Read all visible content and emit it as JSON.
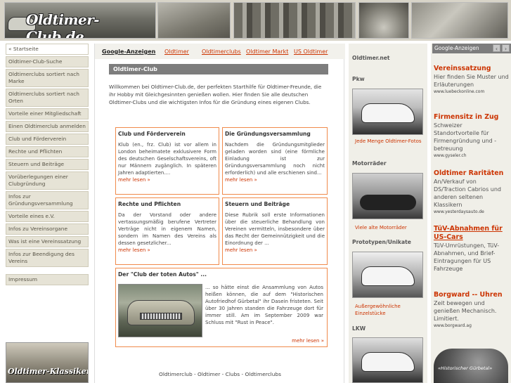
{
  "site": {
    "logo_text": "Oldtimer-Club.de",
    "promo_text": "Oldtimer-Klassiker.de"
  },
  "nav": {
    "items": [
      "« Startseite",
      "Oldtimer-Club-Suche",
      "Oldtimerclubs sortiert nach Marke",
      "Oldtimerclubs sortiert nach Orten",
      "Vorteile einer Mitgliedschaft",
      "Einen Oldtimerclub anmelden",
      "Club und Förderverein",
      "Rechte und Pflichten",
      "Steuern und Beiträge",
      "Vorüberlegungen einer Clubgründung",
      "Infos zur Gründungsversammlung",
      "Vorteile eines e.V.",
      "Infos zu Vereinsorgane",
      "Was ist eine Vereinssatzung",
      "Infos zur Beendigung des Vereins"
    ],
    "impressum": "Impressum"
  },
  "topbar": {
    "google_ads": "Google-Anzeigen",
    "links": [
      "Oldtimer",
      "Oldtimerclubs",
      "Oldtimer Markt",
      "US Oldtimer"
    ]
  },
  "main": {
    "title": "Oldtimer-Club",
    "intro": "Willkommen bei Oldtimer-Club.de, der perfekten Starthilfe für Oldtimer-Freunde, die ihr Hobby mit Gleichgesinnten genießen wollen. Hier finden Sie alle deutschen Oldtimer-Clubs und die wichtigsten Infos für die Gründung eines eigenen Clubs.",
    "more": "mehr lesen »",
    "boxes": [
      {
        "title": "Club und Förderverein",
        "text": "Klub (en., frz. Club) ist vor allem in London beheimatete exklusivere Form des deutschen Geselschaftsvereins, oft nur Männern zugänglich. In späteren Jahren adaptierten...."
      },
      {
        "title": "Die Gründungsversammlung",
        "text": "Nachdem die Gründungsmitglieder geladen worden sind (eine förmliche Einladung ist zur Gründungsversammlung noch nicht erforderlich) und alle erschienen sind..."
      },
      {
        "title": "Rechte und Pflichten",
        "text": "Da der Vorstand oder andere vertassungsmäßig berufene Vertreter Verträge nicht in eigenem Namen, sondern im Namen des Vereins als dessen gesetzlicher..."
      },
      {
        "title": "Steuern und Beiträge",
        "text": "Diese Rubrik soll erste Informationen über die steuerliche Behandlung von Vereinen vermitteln, insbesondere über das Recht der Gemeinnützigkeit und die Einordnung der ..."
      }
    ],
    "feature": {
      "title": "Der \"Club der toten Autos\" ...",
      "text": "... so hätte einst die Ansammlung von Autos heißen können, die auf dem \"Historischen Autofriedhof Gürbetal\" ihr Dasein fristeten. Seit über 30 Jahren standen die Fahrzeuge dort für immer still. Am im September 2009 war Schluss mit \"Rust in Peace\"."
    },
    "footer": "Oldtimerclub - Oldtimer - Clubs - Oldtimerclubs"
  },
  "col3": {
    "header": "Oldtimer.net",
    "sections": [
      {
        "title": "Pkw",
        "link": "Jede Menge Oldtimer-Fotos"
      },
      {
        "title": "Motorräder",
        "link": "Viele alte Motorräder"
      },
      {
        "title": "Prototypen/Unikate",
        "link": "Außergewöhnliche Einzelstücke"
      },
      {
        "title": "LKW",
        "link": ""
      }
    ]
  },
  "ads": {
    "label": "Google-Anzeigen",
    "prev": "‹",
    "next": "›",
    "items": [
      {
        "title": "Vereinssatzung",
        "desc": "Hier finden Sie Muster und Erläuterungen",
        "url": "www.luebeckonline.com"
      },
      {
        "title": "Firmensitz in Zug",
        "desc": "Schweizer Standortvorteile für Firmengründung und -betreuung",
        "url": "www.gyseler.ch"
      },
      {
        "title": "Oldtimer Raritäten",
        "desc": "An/Verkauf von DS/Traction Cabrios und anderen seltenen Klassikern",
        "url": "www.yesterdaysauto.de"
      },
      {
        "title": "TüV-Abnahmen für US-Cars",
        "desc": "TüV-Umrüstungen, TüV-Abnahmen, und Brief-Eintragungen für US Fahrzeuge",
        "url": ""
      },
      {
        "title": "Borgward -- Uhren",
        "desc": "Zeit bewegen und genießen Mechanisch. Limitiert.",
        "url": "www.borgward.ag"
      }
    ],
    "badge_text": "«Historischer  Gürbetal»"
  }
}
